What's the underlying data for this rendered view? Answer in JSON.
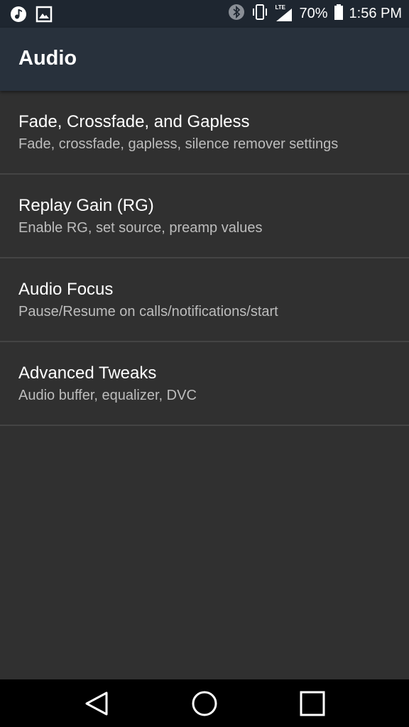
{
  "status_bar": {
    "icons_left": [
      "music-note-icon",
      "image-icon"
    ],
    "icons_right": [
      "bluetooth-icon",
      "vibrate-icon",
      "lte-signal-icon",
      "battery-icon"
    ],
    "network_label": "LTE",
    "battery": "70%",
    "time": "1:56 PM"
  },
  "app_bar": {
    "title": "Audio"
  },
  "settings": [
    {
      "title": "Fade, Crossfade, and Gapless",
      "summary": "Fade, crossfade, gapless, silence remover settings"
    },
    {
      "title": "Replay Gain (RG)",
      "summary": "Enable RG, set source, preamp values"
    },
    {
      "title": "Audio Focus",
      "summary": "Pause/Resume on calls/notifications/start"
    },
    {
      "title": "Advanced Tweaks",
      "summary": "Audio buffer, equalizer, DVC"
    }
  ],
  "nav_bar": {
    "buttons": [
      "back-icon",
      "home-icon",
      "recents-icon"
    ]
  },
  "colors": {
    "background": "#303030",
    "app_bar": "#28313c",
    "status_bar": "#1e2630",
    "divider": "#444444",
    "secondary_text": "#bdbdbd"
  }
}
